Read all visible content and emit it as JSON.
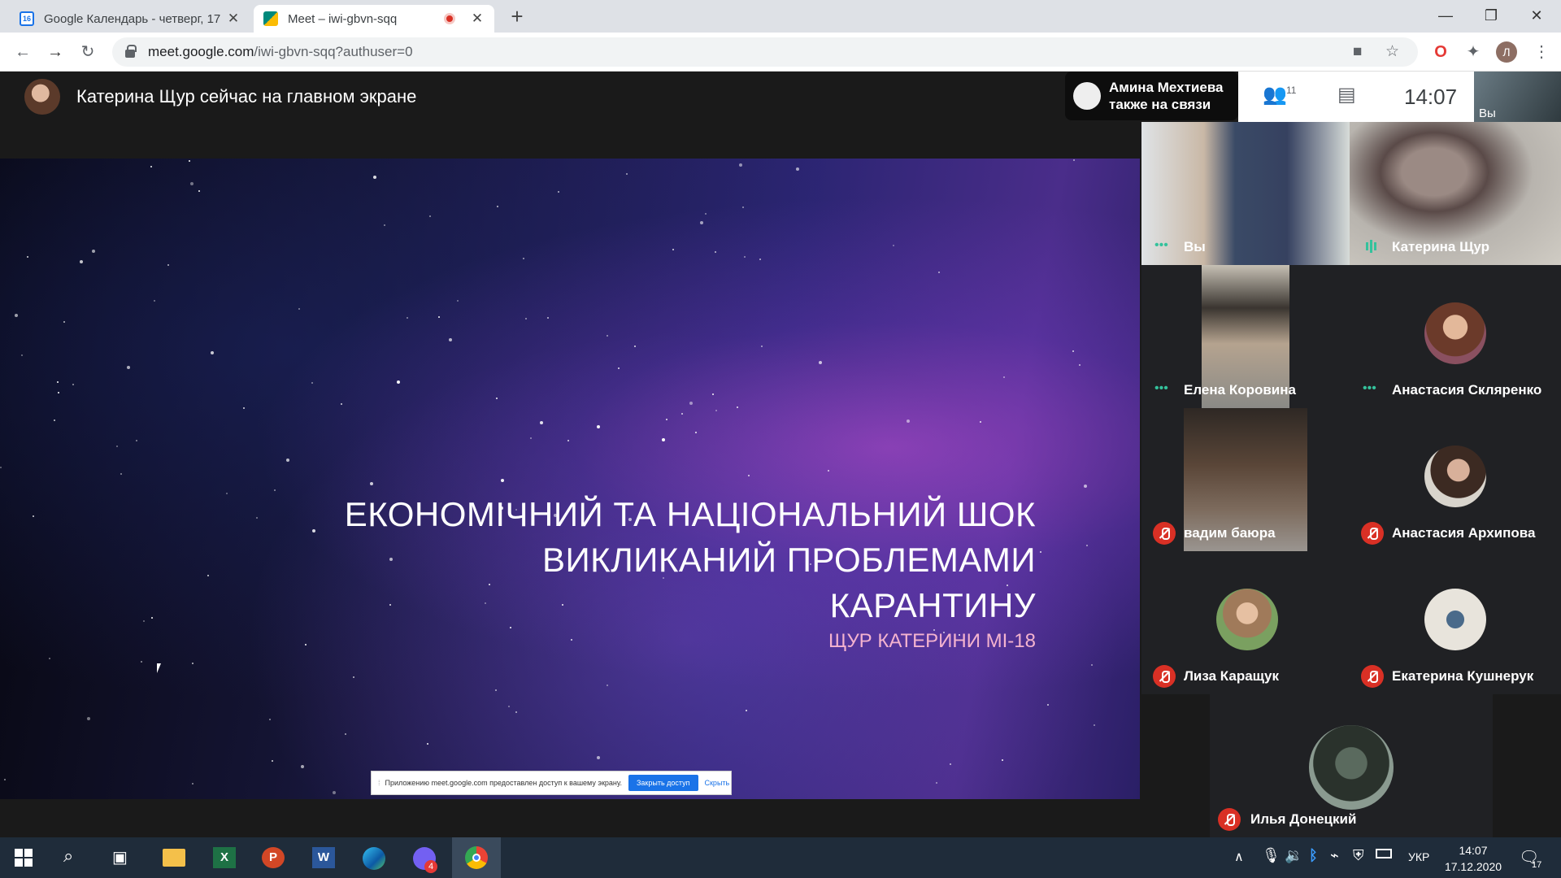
{
  "browser": {
    "tabs": [
      {
        "title": "Google Календарь - четверг, 17",
        "favicon_color": "#1a73e8",
        "favicon_text": "16",
        "active": false
      },
      {
        "title": "Meet – iwi-gbvn-sqq",
        "favicon_color": "#00897b",
        "active": true,
        "recording": true
      }
    ],
    "url_host": "meet.google.com",
    "url_path": "/iwi-gbvn-sqq?authuser=0",
    "profile_initial": "Л"
  },
  "meet": {
    "presenter_banner": "Катерина Щур сейчас на главном экране",
    "joined_notice_name": "Амина Мехтиева",
    "joined_notice_text": "также на связи",
    "participants_count": "11",
    "clock": "14:07",
    "self_mini_label": "Вы",
    "slide": {
      "title_line1": "ЕКОНОМІЧНИЙ ТА НАЦІОНАЛЬНИЙ ШОК",
      "title_line2": "ВИКЛИКАНИЙ ПРОБЛЕМАМИ",
      "title_line3": "КАРАНТИНУ",
      "subtitle": "ЩУР КАТЕРИНИ МІ-18"
    },
    "share_bar": {
      "message": "Приложению meet.google.com предоставлен доступ к вашему экрану.",
      "stop_label": "Закрыть доступ",
      "hide_label": "Скрыть"
    },
    "participants": [
      {
        "name": "Вы",
        "status": "dots"
      },
      {
        "name": "Катерина Щур",
        "status": "talk"
      },
      {
        "name": "Елена Коровина",
        "status": "dots"
      },
      {
        "name": "Анастасия Скляренко",
        "status": "dots"
      },
      {
        "name": "вадим баюра",
        "status": "mic-off"
      },
      {
        "name": "Анастасия Архипова",
        "status": "mic-off"
      },
      {
        "name": "Лиза Каращук",
        "status": "mic-off"
      },
      {
        "name": "Екатерина Кушнерук",
        "status": "mic-off"
      },
      {
        "name": "Илья Донецкий",
        "status": "mic-off"
      }
    ]
  },
  "taskbar": {
    "language": "УКР",
    "time": "14:07",
    "date": "17.12.2020",
    "viber_badge": "4",
    "notification_count": "17"
  }
}
